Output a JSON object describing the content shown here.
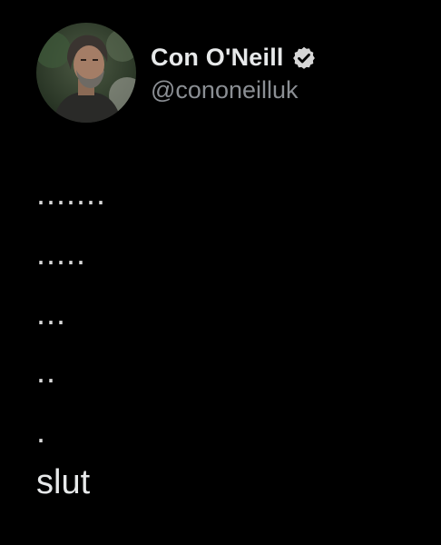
{
  "author": {
    "display_name": "Con O'Neill",
    "handle": "@cononeilluk",
    "verified": true,
    "avatar_icon": "profile-photo",
    "verified_icon": "verified-badge-icon"
  },
  "tweet": {
    "lines": [
      ".......",
      ".....",
      "...",
      "..",
      ".",
      "slut"
    ]
  },
  "colors": {
    "background": "#000000",
    "name": "#e7e9ea",
    "handle": "#8b8f94",
    "text": "#e7e9ea"
  }
}
